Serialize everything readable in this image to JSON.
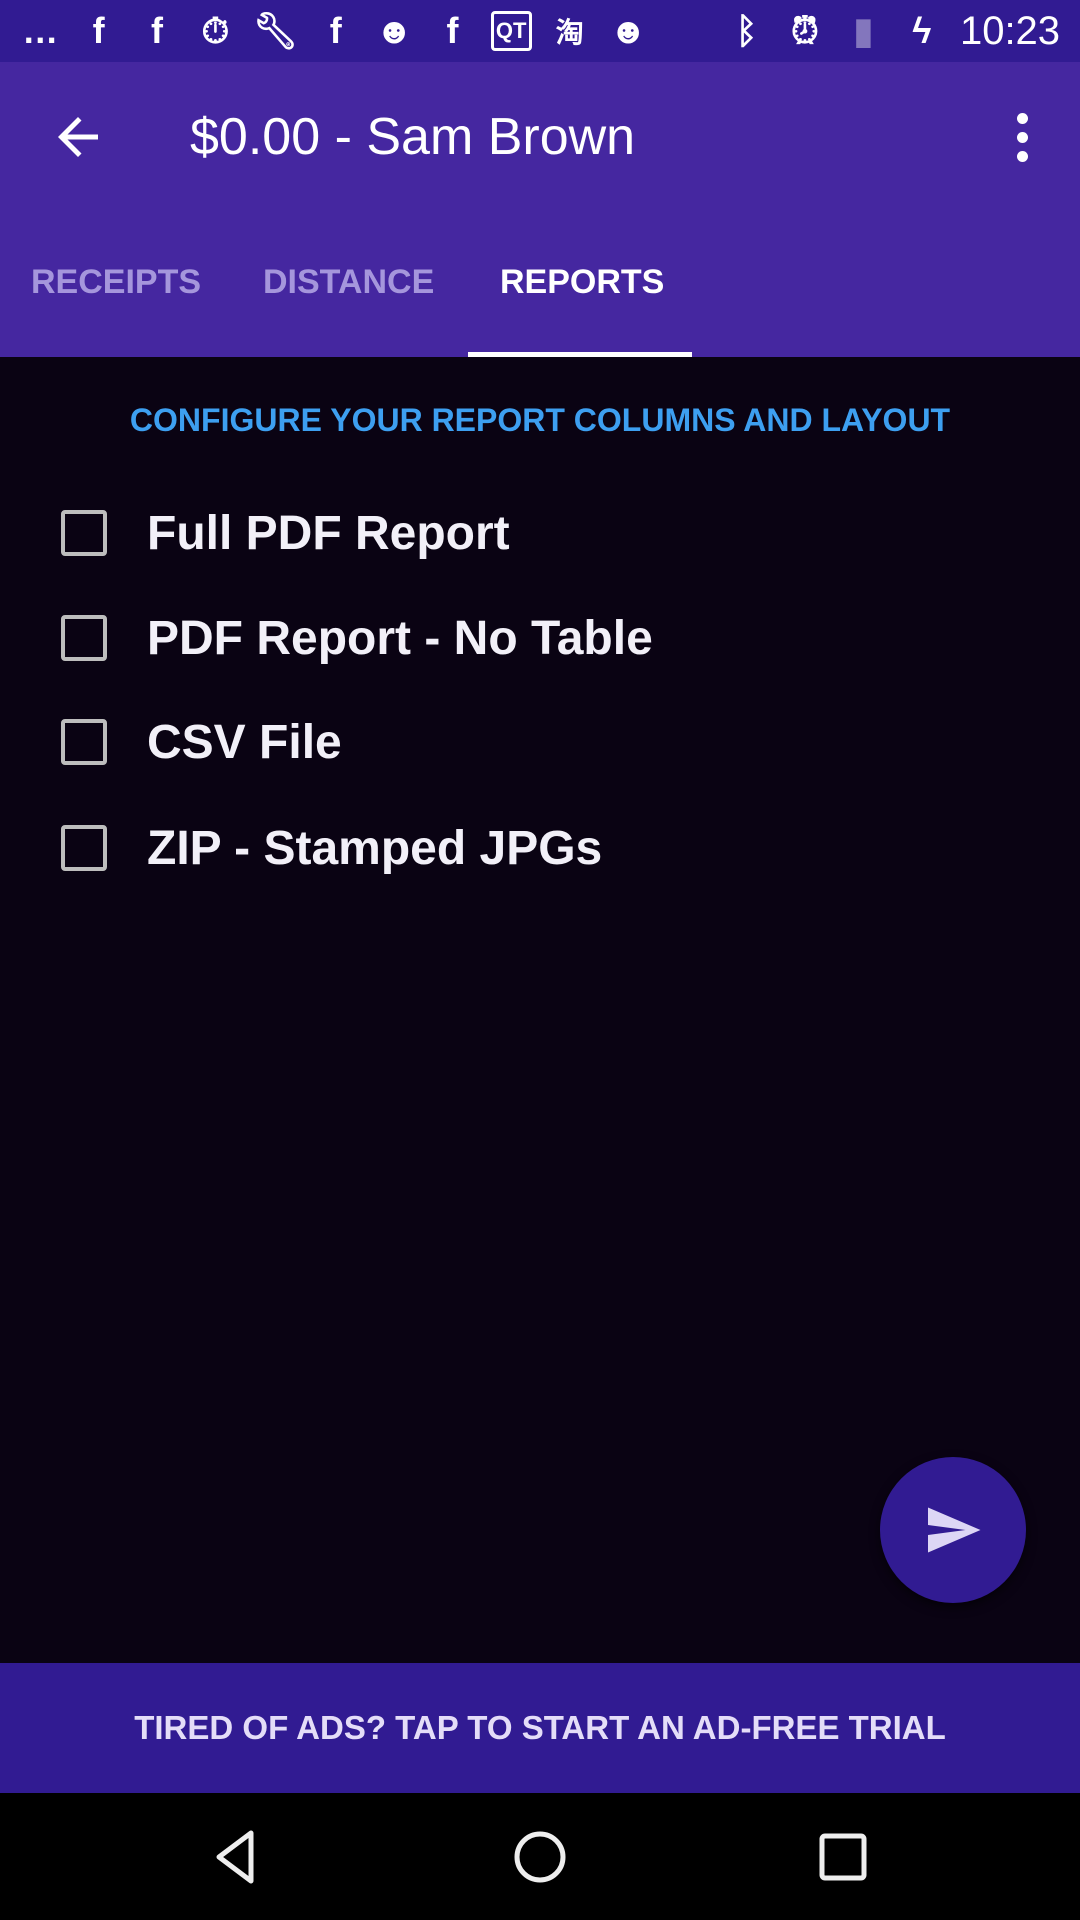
{
  "status_bar": {
    "time": "10:23",
    "notification_icons": [
      "messenger-icon",
      "facebook-icon",
      "facebook-icon",
      "stopwatch-icon",
      "wrench-icon",
      "facebook-icon",
      "smiley-icon",
      "facebook-icon",
      "qt-icon",
      "taobao-icon",
      "smiley-icon"
    ],
    "system_icons": [
      "bluetooth-icon",
      "alarm-icon",
      "no-sim-icon",
      "battery-charging-icon"
    ]
  },
  "app_bar": {
    "title": "$0.00 - Sam Brown"
  },
  "tabs": [
    {
      "label": "RECEIPTS",
      "active": false
    },
    {
      "label": "DISTANCE",
      "active": false
    },
    {
      "label": "REPORTS",
      "active": true
    }
  ],
  "reports": {
    "heading": "CONFIGURE YOUR REPORT COLUMNS AND LAYOUT",
    "options": [
      {
        "label": "Full PDF Report",
        "checked": false
      },
      {
        "label": "PDF Report - No Table",
        "checked": false
      },
      {
        "label": "CSV File",
        "checked": false
      },
      {
        "label": "ZIP - Stamped JPGs",
        "checked": false
      }
    ]
  },
  "ad_banner": {
    "text": "TIRED OF ADS? TAP TO START AN AD-FREE TRIAL"
  },
  "colors": {
    "status_bar": "#311b92",
    "app_bar": "#4527a0",
    "accent": "#3d9ff0",
    "background": "#0a0313"
  }
}
